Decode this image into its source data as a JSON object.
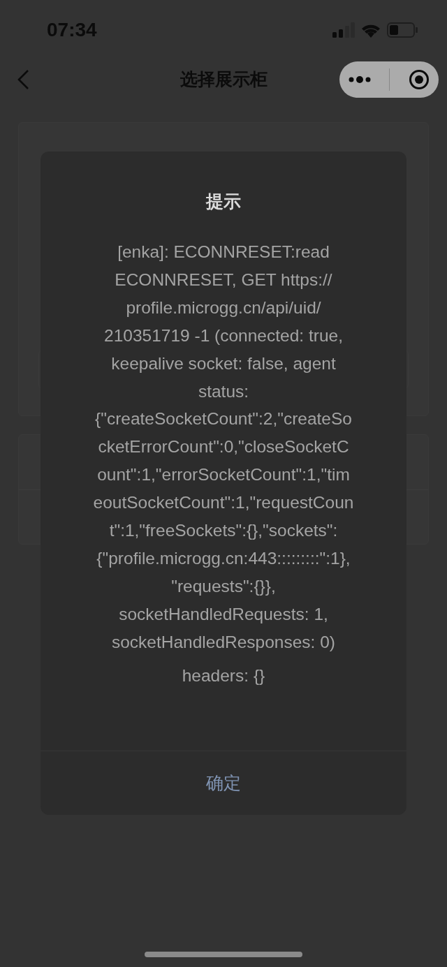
{
  "status_bar": {
    "time": "07:34"
  },
  "nav_bar": {
    "title": "选择展示柜"
  },
  "dialog": {
    "title": "提示",
    "message_lines": [
      "[enka]: ECONNRESET:read",
      "ECONNRESET, GET https://",
      "profile.microgg.cn/api/uid/",
      "210351719 -1 (connected: true,",
      "keepalive socket: false, agent",
      "status:",
      "{\"createSocketCount\":2,\"createSo",
      "cketErrorCount\":0,\"closeSocketC",
      "ount\":1,\"errorSocketCount\":1,\"tim",
      "eoutSocketCount\":1,\"requestCoun",
      "t\":1,\"freeSockets\":{},\"sockets\":",
      "{\"profile.microgg.cn:443:::::::::\":1},",
      "\"requests\":{}},",
      "socketHandledRequests: 1,",
      "socketHandledResponses: 0)"
    ],
    "headers": "headers: {}",
    "button": "确定"
  }
}
